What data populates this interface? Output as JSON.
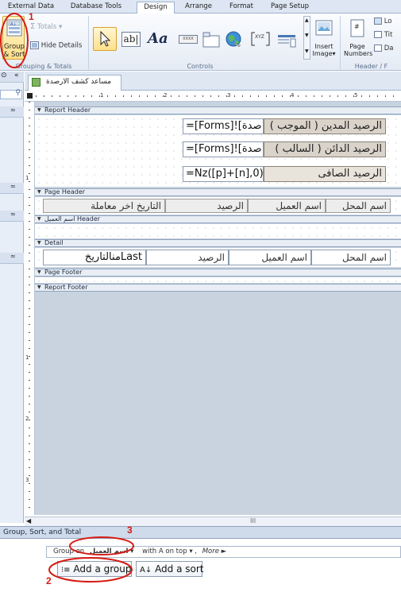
{
  "ribbon": {
    "tabs": [
      "External Data",
      "Database Tools",
      "Design",
      "Arrange",
      "Format",
      "Page Setup"
    ],
    "active_tab": "Design",
    "groups": {
      "grouping_label": "Grouping & Totals",
      "controls_label": "Controls",
      "header_label": "Header / F"
    },
    "buttons": {
      "group_sort_line1": "Group",
      "group_sort_line2": "& Sort",
      "totals": "Totals",
      "hide_details": "Hide Details",
      "label_glyph": "Aa",
      "textbox_glyph": "ab|",
      "insert_image_line1": "Insert",
      "insert_image_line2": "Image",
      "page_numbers_line1": "Page",
      "page_numbers_line2": "Numbers",
      "logo_trunc": "Lo",
      "title_trunc": "Tit",
      "date_trunc": "Da",
      "xyz_glyph": "XYZ",
      "xxxx_glyph": "XXXX"
    }
  },
  "document": {
    "tab_title": "مساعد كشف الارصدة",
    "ruler_numbers": [
      "1",
      "2",
      "3",
      "4",
      "5"
    ],
    "vruler_numbers": [
      "1",
      "1",
      "2",
      "3"
    ]
  },
  "report": {
    "sections": {
      "report_header": "Report Header",
      "page_header": "Page Header",
      "group_header": "اسم العميل Header",
      "detail": "Detail",
      "page_footer": "Page Footer",
      "report_footer": "Report Footer"
    },
    "header_controls": [
      {
        "value": "=[Forms]![صدة",
        "label": "الرصيد المدين ( الموجب )"
      },
      {
        "value": "=[Forms]![صدة",
        "label": "الرصيد الدائن ( السالب )"
      },
      {
        "value": "=Nz([p]+[n],0)",
        "label": "الرصيد الصافى"
      }
    ],
    "page_header_labels": [
      "اسم المحل",
      "اسم العميل",
      "الرصيد",
      "التاريخ اخر معاملة"
    ],
    "detail_controls": [
      "اسم المحل",
      "اسم العميل",
      "الرصيد",
      "Lastمنالتاريخ"
    ]
  },
  "gst": {
    "title": "Group, Sort, and Total",
    "group_on_prefix": "Group on",
    "group_field": "اسم العميل",
    "order": "with A on top",
    "more": "More ►",
    "add_group": "Add a group",
    "add_sort": "Add a sort"
  },
  "annotations": [
    "1",
    "2",
    "3"
  ],
  "colors": {
    "annotation_red": "#d61b12",
    "selected_button": "#ffe08a"
  }
}
